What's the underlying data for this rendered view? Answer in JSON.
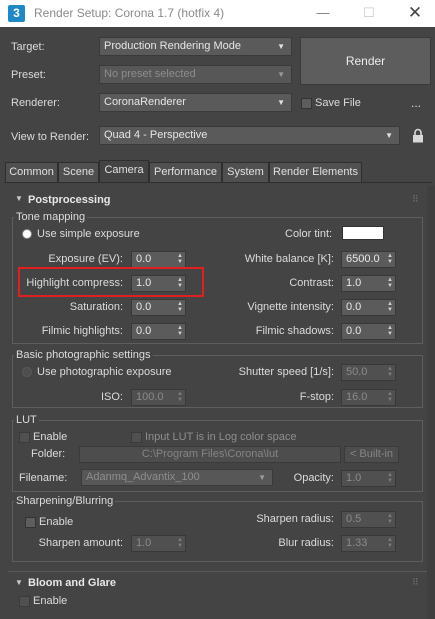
{
  "window": {
    "title": "Render Setup: Corona 1.7 (hotfix 4)",
    "app_icon_glyph": "3",
    "minimize_glyph": "—",
    "maximize_glyph": "☐",
    "close_glyph": "✕"
  },
  "header": {
    "target_label": "Target:",
    "target_value": "Production Rendering Mode",
    "preset_label": "Preset:",
    "preset_value": "No preset selected",
    "renderer_label": "Renderer:",
    "renderer_value": "CoronaRenderer",
    "save_file_label": "Save File",
    "view_label": "View to Render:",
    "view_value": "Quad 4 - Perspective",
    "render_button": "Render",
    "more_button": "..."
  },
  "tabs": [
    {
      "label": "Common"
    },
    {
      "label": "Scene"
    },
    {
      "label": "Camera",
      "active": true
    },
    {
      "label": "Performance"
    },
    {
      "label": "System"
    },
    {
      "label": "Render Elements"
    }
  ],
  "postprocessing": {
    "header": "Postprocessing",
    "tone_mapping": {
      "title": "Tone mapping",
      "use_simple_exposure": "Use simple exposure",
      "color_tint_label": "Color tint:",
      "exposure_label": "Exposure (EV):",
      "exposure_value": "0.0",
      "white_balance_label": "White balance [K]:",
      "white_balance_value": "6500.0",
      "highlight_label": "Highlight compress:",
      "highlight_value": "1.0",
      "contrast_label": "Contrast:",
      "contrast_value": "1.0",
      "saturation_label": "Saturation:",
      "saturation_value": "0.0",
      "vignette_label": "Vignette intensity:",
      "vignette_value": "0.0",
      "filmic_highlights_label": "Filmic highlights:",
      "filmic_highlights_value": "0.0",
      "filmic_shadows_label": "Filmic shadows:",
      "filmic_shadows_value": "0.0"
    },
    "photographic": {
      "title": "Basic photographic settings",
      "use_photo_exposure": "Use photographic exposure",
      "shutter_label": "Shutter speed [1/s]:",
      "shutter_value": "50.0",
      "iso_label": "ISO:",
      "iso_value": "100.0",
      "fstop_label": "F-stop:",
      "fstop_value": "16.0"
    },
    "lut": {
      "title": "LUT",
      "enable_label": "Enable",
      "log_label": "Input LUT is in Log color space",
      "folder_label": "Folder:",
      "folder_value": "C:\\Program Files\\Corona\\lut",
      "builtin_button": "< Built-in",
      "filename_label": "Filename:",
      "filename_value": "Adanmq_Advantix_100",
      "opacity_label": "Opacity:",
      "opacity_value": "1.0"
    },
    "sharpen": {
      "title": "Sharpening/Blurring",
      "enable_label": "Enable",
      "sharpen_radius_label": "Sharpen radius:",
      "sharpen_radius_value": "0.5",
      "sharpen_amount_label": "Sharpen amount:",
      "sharpen_amount_value": "1.0",
      "blur_radius_label": "Blur radius:",
      "blur_radius_value": "1.33"
    }
  },
  "bloom": {
    "header": "Bloom and Glare",
    "enable_label": "Enable"
  },
  "colors": {
    "background": "#444444",
    "highlight_outline": "#e02020",
    "color_tint_swatch": "#ffffff"
  }
}
